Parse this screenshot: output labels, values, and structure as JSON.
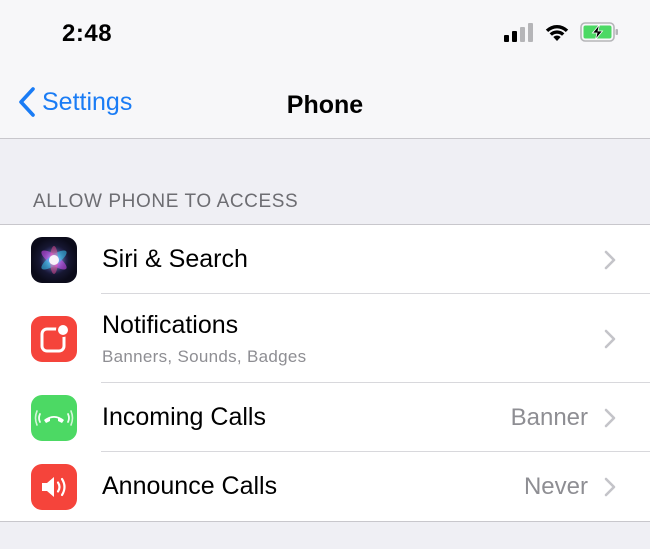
{
  "status_bar": {
    "time": "2:48"
  },
  "nav": {
    "back_label": "Settings",
    "title": "Phone"
  },
  "section": {
    "header": "ALLOW PHONE TO ACCESS"
  },
  "rows": [
    {
      "title": "Siri & Search",
      "icon": "siri-icon"
    },
    {
      "title": "Notifications",
      "subtitle": "Banners, Sounds, Badges",
      "icon": "notifications-icon"
    },
    {
      "title": "Incoming Calls",
      "value": "Banner",
      "icon": "incoming-calls-icon"
    },
    {
      "title": "Announce Calls",
      "value": "Never",
      "icon": "announce-calls-icon"
    }
  ],
  "colors": {
    "accent": "#1a7cf5",
    "notifications_red": "#f5443b",
    "calls_green": "#4cd964",
    "announce_red": "#f5443b",
    "battery_green": "#4cd964"
  }
}
